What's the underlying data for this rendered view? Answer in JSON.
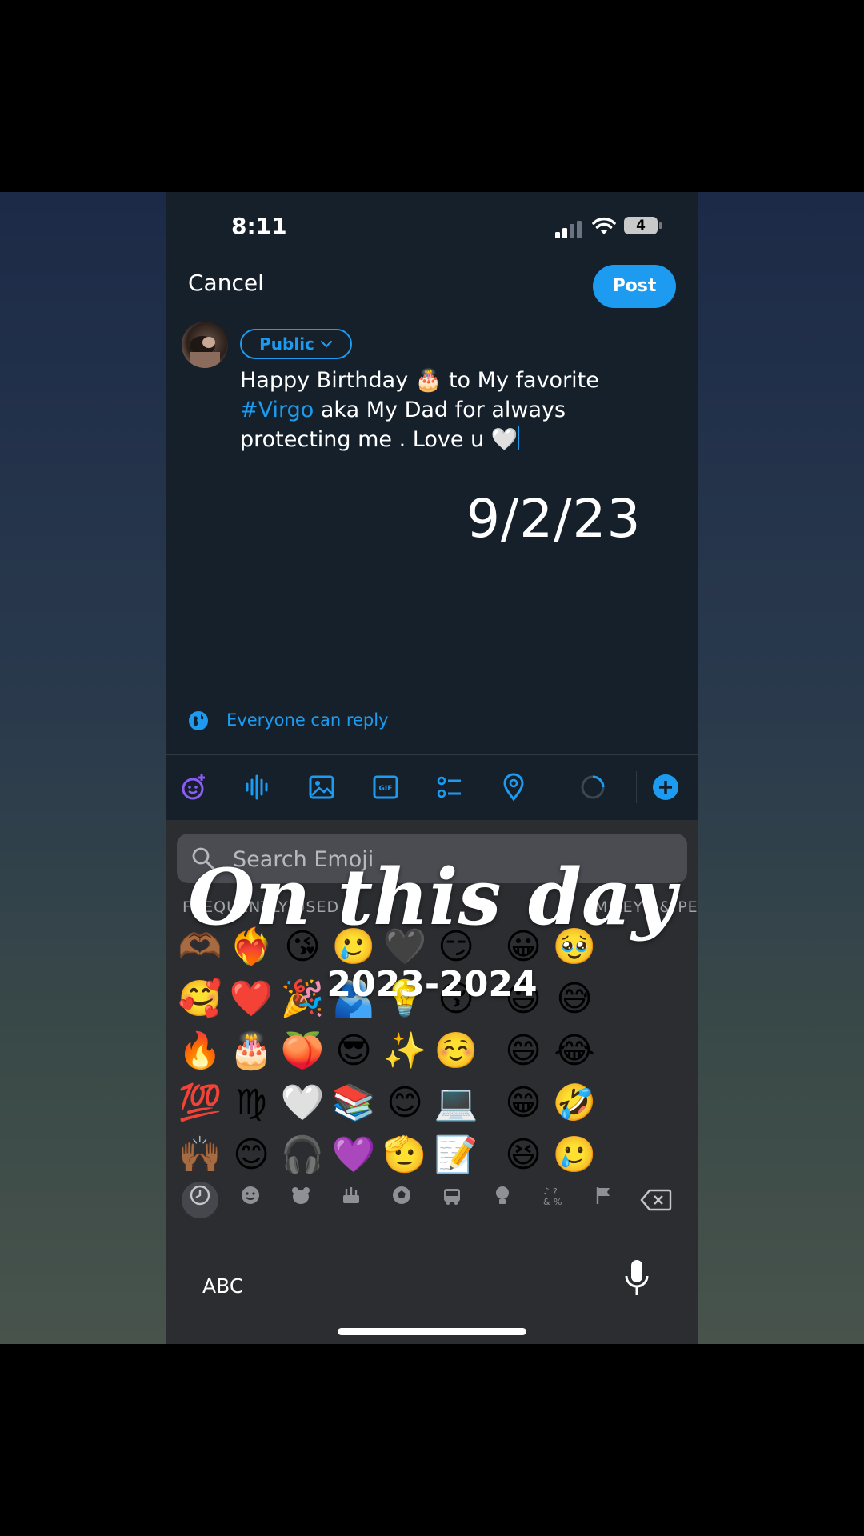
{
  "status_bar": {
    "time": "8:11",
    "battery": "4"
  },
  "compose": {
    "cancel_label": "Cancel",
    "post_label": "Post",
    "audience_label": "Public",
    "text_before_cake": "Happy Birthday ",
    "cake_emoji": "🎂",
    "text_after_cake": " to My favorite",
    "hashtag": "#Virgo",
    "text_after_hashtag": "  aka  My Dad  for always protecting me .  Love u ",
    "heart_emoji": "🤍",
    "reply_setting": "Everyone can reply"
  },
  "overlay_date": "9/2/23",
  "toolbar": {
    "icons": [
      "grok-icon",
      "voice-icon",
      "image-icon",
      "gif-icon",
      "poll-icon",
      "location-icon",
      "character-count-ring",
      "add-post-icon"
    ],
    "gif_text": "GIF"
  },
  "emoji_keyboard": {
    "search_placeholder": "Search Emoji",
    "section_frequent": "FREQUENTLY USED",
    "section_smileys": "SMILEYS & PE",
    "rows": [
      [
        "🫶🏾",
        "❤️‍🔥",
        "😘",
        "🥲",
        "🖤",
        "😏",
        "😀",
        "🥹"
      ],
      [
        "🥰",
        "❤️",
        "🎉",
        "🫂",
        "💡",
        "😚",
        "😃",
        "😅"
      ],
      [
        "🔥",
        "🎂",
        "🍑",
        "😎",
        "✨",
        "☺️",
        "😄",
        "😂"
      ],
      [
        "💯",
        "♍",
        "🤍",
        "📚",
        "😊",
        "💻",
        "😁",
        "🤣"
      ],
      [
        "🙌🏾",
        "😊",
        "🎧",
        "💜",
        "🫡",
        "📝",
        "😆",
        "🥲"
      ]
    ],
    "categories": [
      "recent-icon",
      "smiley-icon",
      "animal-icon",
      "food-icon",
      "activity-icon",
      "travel-icon",
      "objects-icon",
      "symbols-icon",
      "flag-icon"
    ],
    "abc_label": "ABC"
  },
  "on_this_day": {
    "title": "On this day",
    "years": "2023-2024"
  }
}
